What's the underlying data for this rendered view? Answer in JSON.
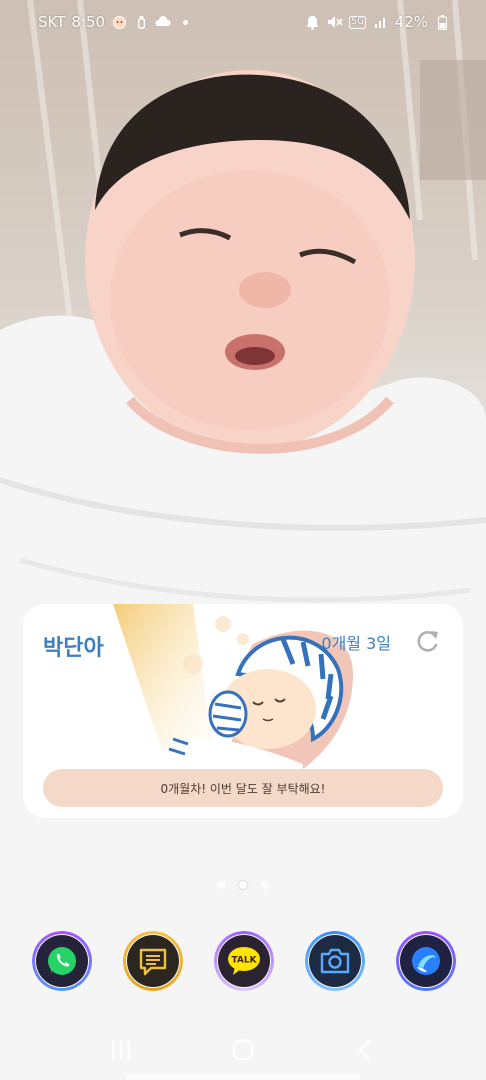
{
  "status_bar": {
    "carrier": "SKT",
    "time": "8:50",
    "battery": "42%",
    "network_badge": "5G",
    "icons": [
      "baby-face-icon",
      "baby-bottle-icon",
      "cloud-icon",
      "notification-dot",
      "alarm-icon",
      "mute-icon",
      "signal-icon",
      "battery-icon"
    ]
  },
  "widget": {
    "baby_name": "박단아",
    "age": "0개월 3일",
    "message": "0개월차! 이번 달도 잘 부탁해요!",
    "refresh_icon": "refresh-icon"
  },
  "page_indicator": {
    "count": 3,
    "active_index": 1
  },
  "dock": [
    {
      "name": "whatsapp",
      "icon": "phone-chat-icon",
      "accent": "#25d366"
    },
    {
      "name": "messages",
      "icon": "message-icon",
      "accent": "#f1bf3f"
    },
    {
      "name": "kakaotalk",
      "icon": "talk-bubble-icon",
      "label": "TALK",
      "accent": "#fee500"
    },
    {
      "name": "camera",
      "icon": "camera-icon",
      "accent": "#3a8cff"
    },
    {
      "name": "browser",
      "icon": "whale-icon",
      "accent": "#2a8cff"
    }
  ],
  "nav": {
    "recent": "recent-apps-icon",
    "home": "home-icon",
    "back": "back-icon"
  },
  "colors": {
    "accent_blue": "#3c7fc2",
    "message_bg": "#f4d9c9"
  }
}
